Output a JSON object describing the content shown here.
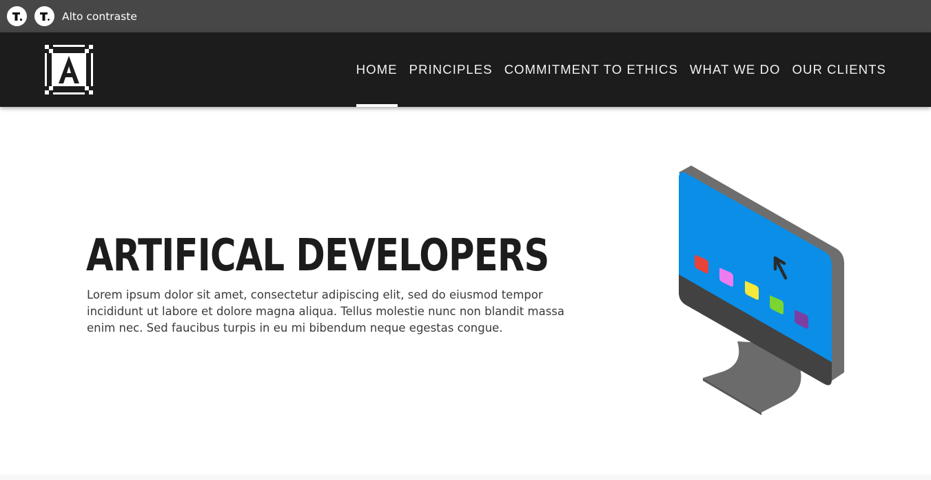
{
  "toolbar": {
    "buttons": [
      {
        "name": "text-size-decrease",
        "glyph": "T"
      },
      {
        "name": "text-size-increase",
        "glyph": "T"
      }
    ],
    "contrast_label": "Alto contraste"
  },
  "header": {
    "logo_letter": "A",
    "nav": [
      {
        "label": "HOME",
        "active": true
      },
      {
        "label": "PRINCIPLES",
        "active": false
      },
      {
        "label": "COMMITMENT TO ETHICS",
        "active": false
      },
      {
        "label": "WHAT WE DO",
        "active": false
      },
      {
        "label": "OUR CLIENTS",
        "active": false
      }
    ]
  },
  "hero": {
    "title": "ARTIFICAL DEVELOPERS",
    "text": "Lorem ipsum dolor sit amet, consectetur adipiscing elit, sed do eiusmod tempor incididunt ut labore et dolore magna aliqua. Tellus molestie nunc non blandit massa enim nec. Sed faucibus turpis in eu mi bibendum neque egestas congue."
  },
  "colors": {
    "toolbar_bg": "#474747",
    "header_bg": "#1c1c1c",
    "screen_blue": "#0a8ee8",
    "app_icons": [
      "#e8433a",
      "#ee7cf0",
      "#f4e83a",
      "#7ad530",
      "#7a3fa3"
    ]
  }
}
